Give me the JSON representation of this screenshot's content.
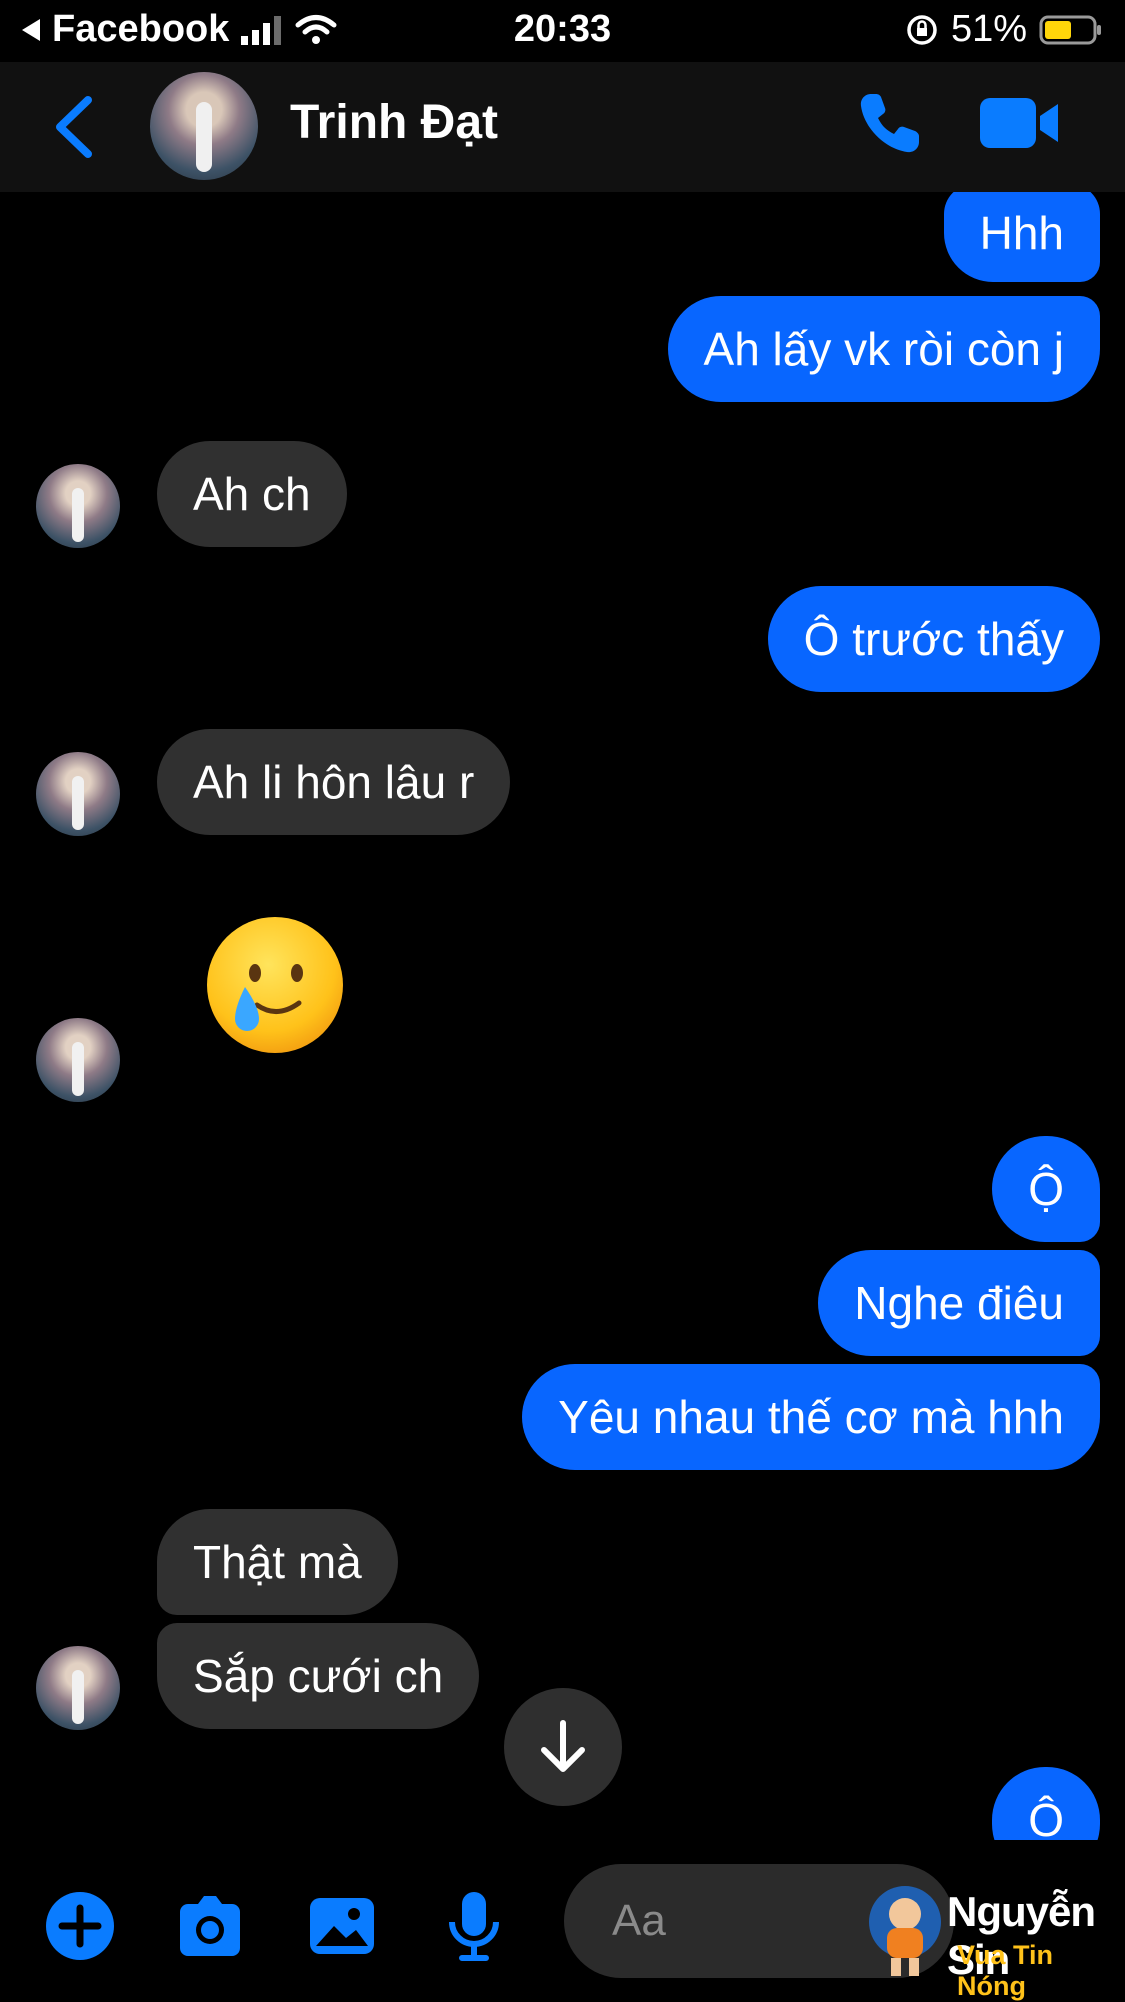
{
  "status_bar": {
    "back_app": "Facebook",
    "time": "20:33",
    "battery": "51%"
  },
  "header": {
    "contact_name": "Trinh Đạt"
  },
  "messages": [
    {
      "side": "out",
      "text": "Hhh"
    },
    {
      "side": "out",
      "text": "Ah lấy vk ròi còn j"
    },
    {
      "side": "in",
      "text": "Ah ch"
    },
    {
      "side": "out",
      "text": "Ô trước thấy"
    },
    {
      "side": "in",
      "text": "Ah li hôn lâu r"
    },
    {
      "side": "in",
      "text": "🥲",
      "type": "emoji"
    },
    {
      "side": "out",
      "text": "Ộ"
    },
    {
      "side": "out",
      "text": "Nghe điêu"
    },
    {
      "side": "out",
      "text": "Yêu nhau thế cơ mà hhh"
    },
    {
      "side": "in",
      "text": "Thật mà"
    },
    {
      "side": "in",
      "text": "Sắp cưới ch"
    },
    {
      "side": "out",
      "text": "Ô"
    }
  ],
  "composer": {
    "placeholder": "Aa"
  },
  "watermark": {
    "name": "Nguyễn Sin",
    "tagline": "Vua Tin Nóng"
  },
  "colors": {
    "accent": "#0866ff",
    "incoming_bubble": "#303030",
    "background": "#000000"
  }
}
